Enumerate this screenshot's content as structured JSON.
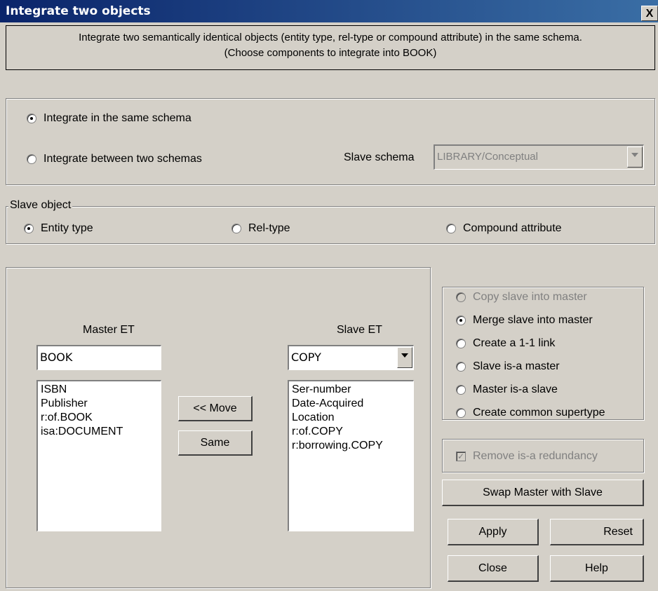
{
  "window": {
    "title": "Integrate two objects",
    "close_glyph": "X"
  },
  "description": {
    "line1": "Integrate two semantically identical objects (entity type, rel-type or compound attribute) in the same schema.",
    "line2": "(Choose components to integrate into BOOK)"
  },
  "scope": {
    "same_schema_label": "Integrate in the same schema",
    "between_schemas_label": "Integrate between two schemas",
    "slave_schema_label": "Slave schema",
    "slave_schema_value": "LIBRARY/Conceptual",
    "selected": "same"
  },
  "slave_object": {
    "legend": "Slave object",
    "entity_type_label": "Entity type",
    "rel_type_label": "Rel-type",
    "compound_attribute_label": "Compound attribute",
    "selected": "entity_type"
  },
  "master": {
    "header": "Master ET",
    "value": "BOOK",
    "components": [
      "ISBN",
      "Publisher",
      "r:of.BOOK",
      "isa:DOCUMENT"
    ]
  },
  "slave": {
    "header": "Slave ET",
    "value": "COPY",
    "components": [
      "Ser-number",
      "Date-Acquired",
      "Location",
      "r:of.COPY",
      "r:borrowing.COPY"
    ]
  },
  "actions": {
    "move_label": "<< Move",
    "same_label": "Same"
  },
  "integration_mode": {
    "options": [
      {
        "label": "Copy slave into master",
        "enabled": false,
        "selected": false
      },
      {
        "label": "Merge slave into master",
        "enabled": true,
        "selected": true
      },
      {
        "label": "Create a 1-1 link",
        "enabled": true,
        "selected": false
      },
      {
        "label": "Slave is-a master",
        "enabled": true,
        "selected": false
      },
      {
        "label": "Master is-a slave",
        "enabled": true,
        "selected": false
      },
      {
        "label": "Create common supertype",
        "enabled": true,
        "selected": false
      }
    ]
  },
  "remove_isa": {
    "label": "Remove is-a redundancy",
    "checked": true,
    "enabled": false
  },
  "buttons": {
    "swap": "Swap Master with Slave",
    "apply": "Apply",
    "reset": "Reset",
    "close": "Close",
    "help": "Help"
  }
}
